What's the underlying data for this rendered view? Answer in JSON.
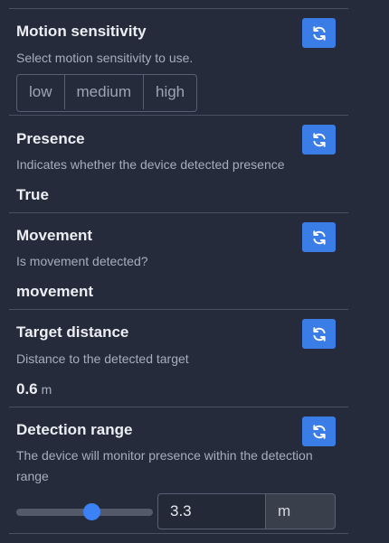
{
  "motion_sensitivity": {
    "title": "Motion sensitivity",
    "description": "Select motion sensitivity to use.",
    "options": [
      "low",
      "medium",
      "high"
    ],
    "refresh_icon": "refresh-icon"
  },
  "presence": {
    "title": "Presence",
    "description": "Indicates whether the device detected presence",
    "value": "True",
    "refresh_icon": "refresh-icon"
  },
  "movement": {
    "title": "Movement",
    "description": "Is movement detected?",
    "value": "movement",
    "refresh_icon": "refresh-icon"
  },
  "target_distance": {
    "title": "Target distance",
    "description": "Distance to the detected target",
    "value": "0.6",
    "unit": "m",
    "refresh_icon": "refresh-icon"
  },
  "detection_range": {
    "title": "Detection range",
    "description": "The device will monitor presence within the detection range",
    "value": "3.3",
    "unit": "m",
    "slider_fraction": 0.55,
    "refresh_icon": "refresh-icon"
  },
  "colors": {
    "background": "#262b3b",
    "accent": "#3b7de6",
    "divider": "#4a5062"
  }
}
